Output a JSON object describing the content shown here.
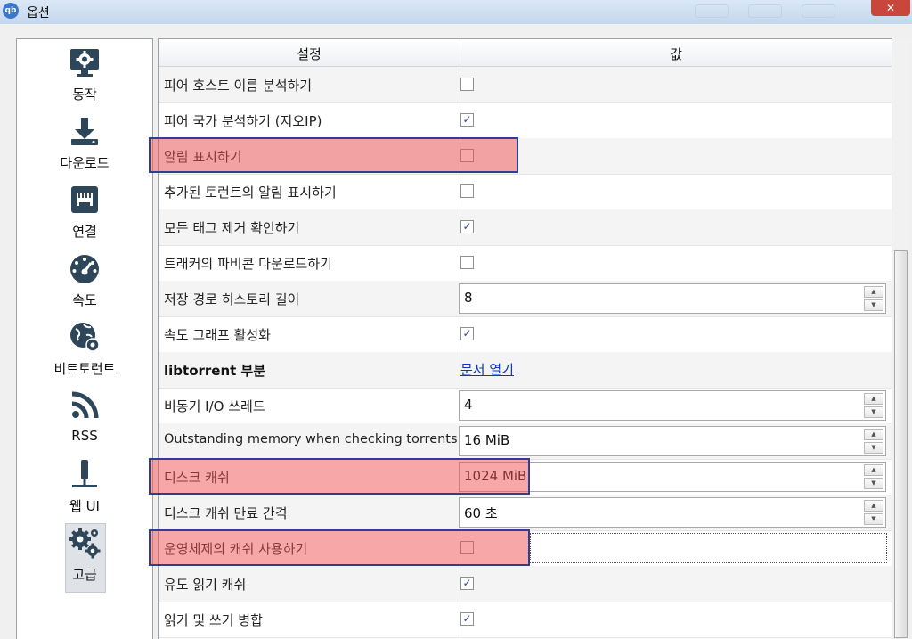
{
  "window": {
    "title": "옵션",
    "icon": "qbittorrent-logo"
  },
  "sidebar": {
    "items": [
      {
        "label": "동작",
        "icon": "monitor-gear-icon"
      },
      {
        "label": "다운로드",
        "icon": "download-icon"
      },
      {
        "label": "연결",
        "icon": "network-port-icon"
      },
      {
        "label": "속도",
        "icon": "speedometer-icon"
      },
      {
        "label": "비트토런트",
        "icon": "globe-gear-icon"
      },
      {
        "label": "RSS",
        "icon": "rss-icon"
      },
      {
        "label": "웹 UI",
        "icon": "web-ui-icon"
      },
      {
        "label": "고급",
        "icon": "gears-icon",
        "selected": true
      }
    ]
  },
  "table": {
    "headers": {
      "setting": "설정",
      "value": "값"
    },
    "rows": [
      {
        "name": "피어 호스트 이름 분석하기",
        "type": "checkbox",
        "checked": false
      },
      {
        "name": "피어 국가 분석하기 (지오IP)",
        "type": "checkbox",
        "checked": true
      },
      {
        "name": "알림 표시하기",
        "type": "checkbox",
        "checked": false,
        "highlighted": true
      },
      {
        "name": "추가된 토런트의 알림 표시하기",
        "type": "checkbox",
        "checked": false
      },
      {
        "name": "모든 태그 제거 확인하기",
        "type": "checkbox",
        "checked": true
      },
      {
        "name": "트래커의 파비콘 다운로드하기",
        "type": "checkbox",
        "checked": false
      },
      {
        "name": "저장 경로 히스토리 길이",
        "type": "spin",
        "value": "8"
      },
      {
        "name": "속도 그래프 활성화",
        "type": "checkbox",
        "checked": true
      },
      {
        "name": "libtorrent 부분",
        "type": "link",
        "value": "문서 열기",
        "bold": true
      },
      {
        "name": "비동기 I/O 쓰레드",
        "type": "spin",
        "value": "4"
      },
      {
        "name": "Outstanding memory when checking torrents",
        "type": "spin",
        "value": "16 MiB"
      },
      {
        "name": "디스크 캐쉬",
        "type": "spin",
        "value": "1024 MiB",
        "highlighted": true
      },
      {
        "name": "디스크 캐쉬 만료 간격",
        "type": "spin",
        "value": "60 초"
      },
      {
        "name": "운영체제의 캐쉬 사용하기",
        "type": "checkbox",
        "checked": false,
        "highlighted": true,
        "focused": true
      },
      {
        "name": "유도 읽기 캐쉬",
        "type": "checkbox",
        "checked": true
      },
      {
        "name": "읽기 및 쓰기 병합",
        "type": "checkbox",
        "checked": true
      }
    ]
  },
  "colors": {
    "highlight": "#f05050",
    "highlight_border": "#2f3f8f",
    "link": "#0b35c9"
  },
  "icons": {
    "checkmark": "✓",
    "spin_up": "▲",
    "spin_down": "▼",
    "close": "✕"
  }
}
